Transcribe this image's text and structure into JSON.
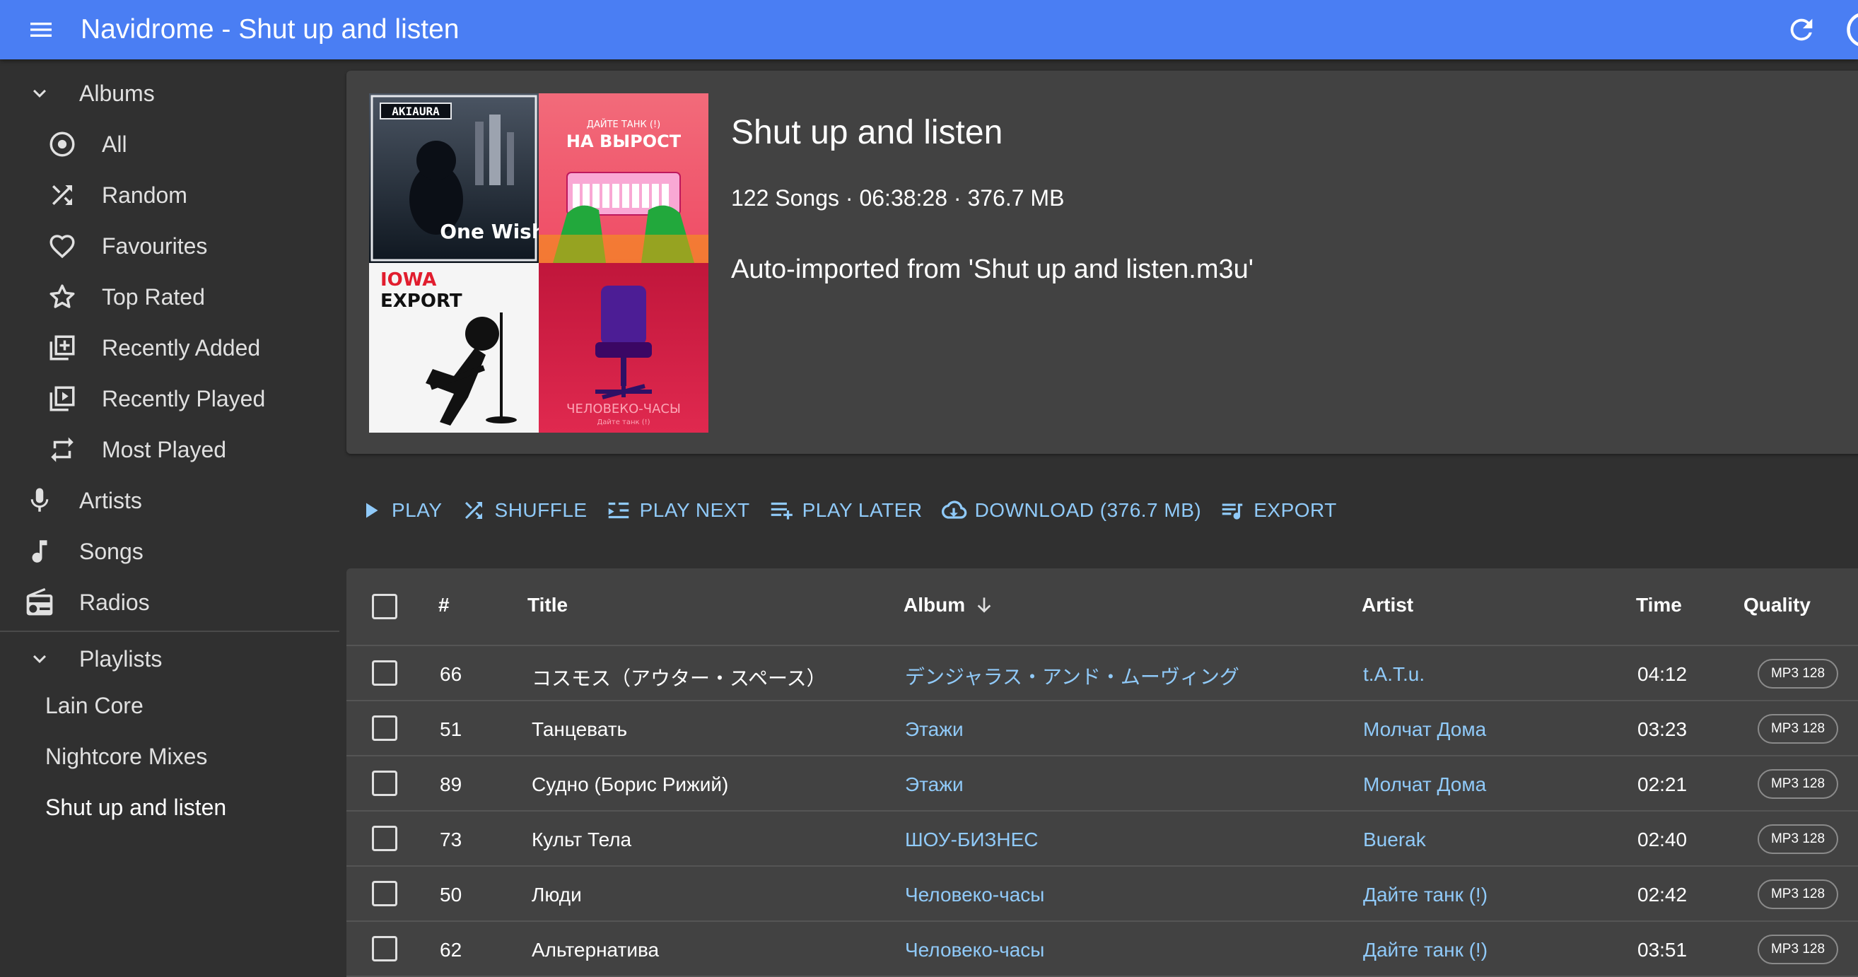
{
  "app": {
    "title": "Navidrome - Shut up and listen",
    "accent": "#4a7ef3",
    "link_color": "#90caf9"
  },
  "sidebar": {
    "albums_label": "Albums",
    "album_items": [
      {
        "label": "All",
        "icon": "album-icon"
      },
      {
        "label": "Random",
        "icon": "shuffle-icon"
      },
      {
        "label": "Favourites",
        "icon": "heart-icon"
      },
      {
        "label": "Top Rated",
        "icon": "star-icon"
      },
      {
        "label": "Recently Added",
        "icon": "library-add-icon"
      },
      {
        "label": "Recently Played",
        "icon": "video-library-icon"
      },
      {
        "label": "Most Played",
        "icon": "repeat-icon"
      }
    ],
    "artists_label": "Artists",
    "songs_label": "Songs",
    "radios_label": "Radios",
    "playlists_label": "Playlists",
    "playlists": [
      "Lain Core",
      "Nightcore Mixes",
      "Shut up and listen"
    ]
  },
  "playlist": {
    "name": "Shut up and listen",
    "stats": "122 Songs · 06:38:28 · 376.7 MB",
    "comment": "Auto-imported from 'Shut up and listen.m3u'",
    "cover_texts": {
      "tile1_top": "AKIAURA",
      "tile1_bottom": "One Wish",
      "tile2_top": "ДАЙТЕ ТАНК (!)",
      "tile2_title": "НА ВЫРОСТ",
      "tile3_top": "IOWA",
      "tile3_sub": "EXPORT",
      "tile4_title": "ЧЕЛОВЕКО-ЧАСЫ",
      "tile4_sub": "Дайте танк (!)"
    }
  },
  "actions": {
    "play": "PLAY",
    "shuffle": "SHUFFLE",
    "play_next": "PLAY NEXT",
    "play_later": "PLAY LATER",
    "download": "DOWNLOAD (376.7 MB)",
    "export": "EXPORT"
  },
  "table": {
    "headers": {
      "num": "#",
      "title": "Title",
      "album": "Album",
      "artist": "Artist",
      "time": "Time",
      "quality": "Quality"
    },
    "sort_column": "Album",
    "rows": [
      {
        "num": "66",
        "title": "コスモス（アウター・スペース）",
        "album": "デンジャラス・アンド・ムーヴィング",
        "artist": "t.A.T.u.",
        "time": "04:12",
        "quality": "MP3 128"
      },
      {
        "num": "51",
        "title": "Танцевать",
        "album": "Этажи",
        "artist": "Молчат Дома",
        "time": "03:23",
        "quality": "MP3 128"
      },
      {
        "num": "89",
        "title": "Судно (Борис Рижий)",
        "album": "Этажи",
        "artist": "Молчат Дома",
        "time": "02:21",
        "quality": "MP3 128"
      },
      {
        "num": "73",
        "title": "Культ Тела",
        "album": "ШОУ-БИЗНЕС",
        "artist": "Buerak",
        "time": "02:40",
        "quality": "MP3 128"
      },
      {
        "num": "50",
        "title": "Люди",
        "album": "Человеко-часы",
        "artist": "Дайте танк (!)",
        "time": "02:42",
        "quality": "MP3 128"
      },
      {
        "num": "62",
        "title": "Альтернатива",
        "album": "Человеко-часы",
        "artist": "Дайте танк (!)",
        "time": "03:51",
        "quality": "MP3 128"
      }
    ]
  }
}
